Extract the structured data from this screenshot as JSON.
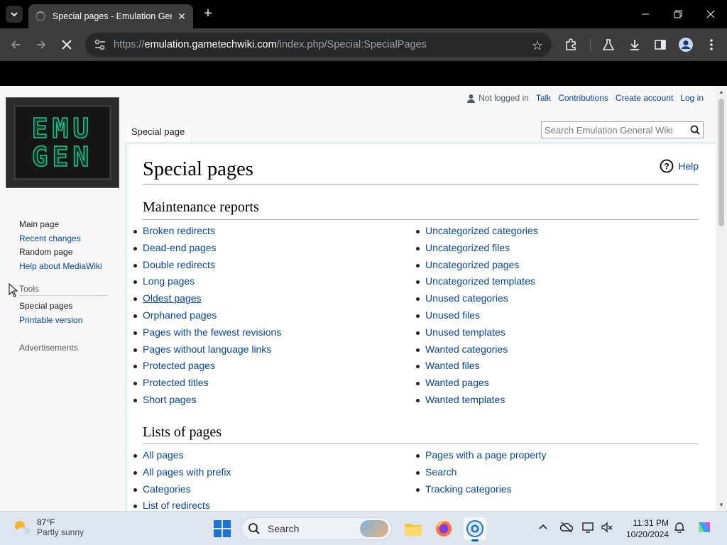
{
  "browser": {
    "tab_title": "Special pages - Emulation General Wiki",
    "url_prefix": "https://",
    "url_host": "emulation.gametechwiki.com",
    "url_path": "/index.php/Special:SpecialPages"
  },
  "page": {
    "logo_line1": "EMU",
    "logo_line2": "GEN",
    "user": {
      "status": "Not logged in",
      "talk": "Talk",
      "contributions": "Contributions",
      "create_account": "Create account",
      "login": "Log in"
    },
    "namespace_tab": "Special page",
    "search_placeholder": "Search Emulation General Wiki",
    "title": "Special pages",
    "help": "Help",
    "sidebar": {
      "main_page": "Main page",
      "recent_changes": "Recent changes",
      "random_page": "Random page",
      "help_mediawiki": "Help about MediaWiki",
      "tools_heading": "Tools",
      "special_pages": "Special pages",
      "printable_version": "Printable version",
      "advertisements": "Advertisements"
    },
    "sections": [
      {
        "heading": "Maintenance reports",
        "left": [
          "Broken redirects",
          "Dead-end pages",
          "Double redirects",
          "Long pages",
          "Oldest pages",
          "Orphaned pages",
          "Pages with the fewest revisions",
          "Pages without language links",
          "Protected pages",
          "Protected titles",
          "Short pages"
        ],
        "right": [
          "Uncategorized categories",
          "Uncategorized files",
          "Uncategorized pages",
          "Uncategorized templates",
          "Unused categories",
          "Unused files",
          "Unused templates",
          "Wanted categories",
          "Wanted files",
          "Wanted pages",
          "Wanted templates"
        ]
      },
      {
        "heading": "Lists of pages",
        "left": [
          "All pages",
          "All pages with prefix",
          "Categories",
          "List of redirects"
        ],
        "right": [
          "Pages with a page property",
          "Search",
          "Tracking categories"
        ]
      }
    ]
  },
  "taskbar": {
    "temp": "87°F",
    "condition": "Partly sunny",
    "search_label": "Search",
    "time": "11:31 PM",
    "date": "10/20/2024"
  }
}
